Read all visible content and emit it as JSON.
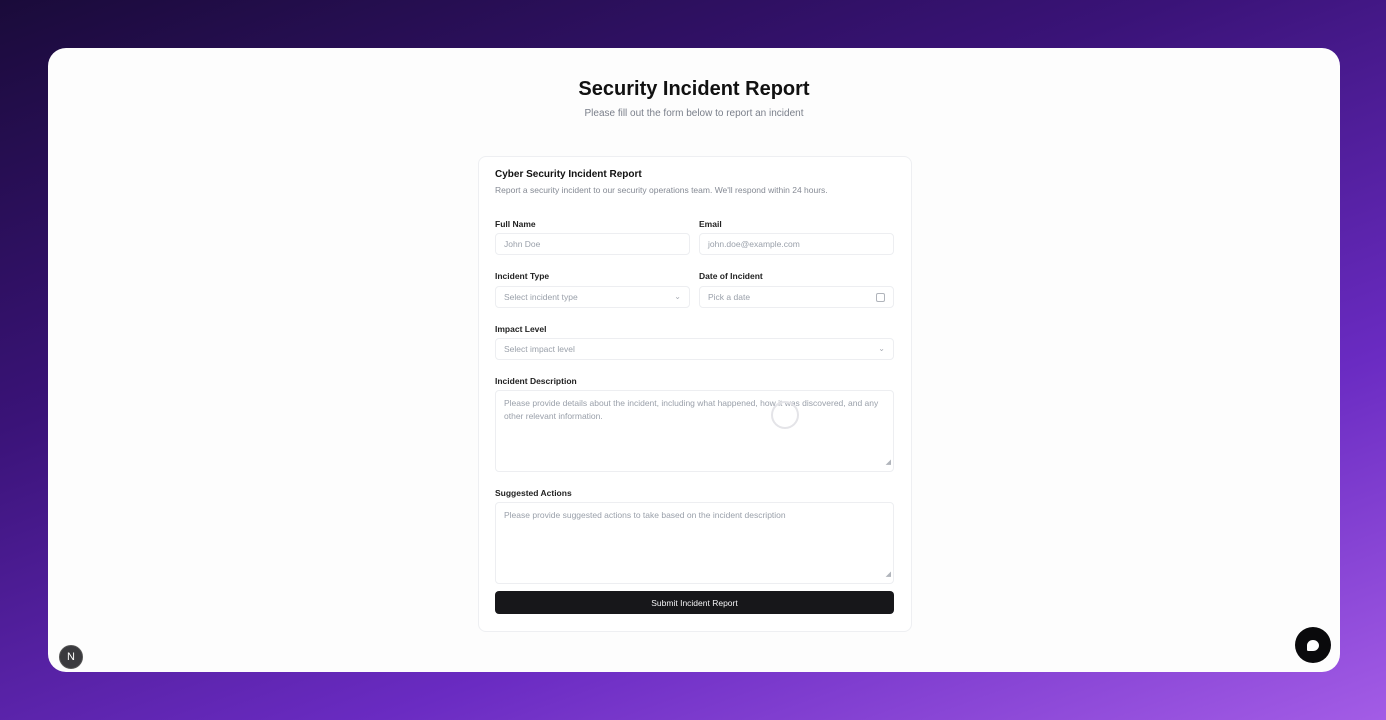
{
  "header": {
    "title": "Security Incident Report",
    "subtitle": "Please fill out the form below to report an incident"
  },
  "card": {
    "title": "Cyber Security Incident Report",
    "description": "Report a security incident to our security operations team. We'll respond within 24 hours."
  },
  "form": {
    "full_name": {
      "label": "Full Name",
      "placeholder": "John Doe"
    },
    "email": {
      "label": "Email",
      "placeholder": "john.doe@example.com"
    },
    "incident_type": {
      "label": "Incident Type",
      "placeholder": "Select incident type",
      "icon": "chevron-down-icon"
    },
    "date": {
      "label": "Date of Incident",
      "placeholder": "Pick a date",
      "icon": "calendar-icon"
    },
    "impact": {
      "label": "Impact Level",
      "placeholder": "Select impact level",
      "icon": "chevron-down-icon"
    },
    "description": {
      "label": "Incident Description",
      "placeholder": "Please provide details about the incident, including what happened, how it was discovered, and any other relevant information."
    },
    "actions": {
      "label": "Suggested Actions",
      "placeholder": "Please provide suggested actions to take based on the incident description"
    },
    "submit_label": "Submit Incident Report"
  },
  "overlay": {
    "next_badge": "N",
    "chat_icon": "chat-bubble-icon",
    "spinner_icon": "loading-spinner-icon"
  },
  "colors": {
    "background_gradient_start": "#1a0b3a",
    "background_gradient_end": "#a35ce6",
    "submit_bg": "#17171a"
  }
}
